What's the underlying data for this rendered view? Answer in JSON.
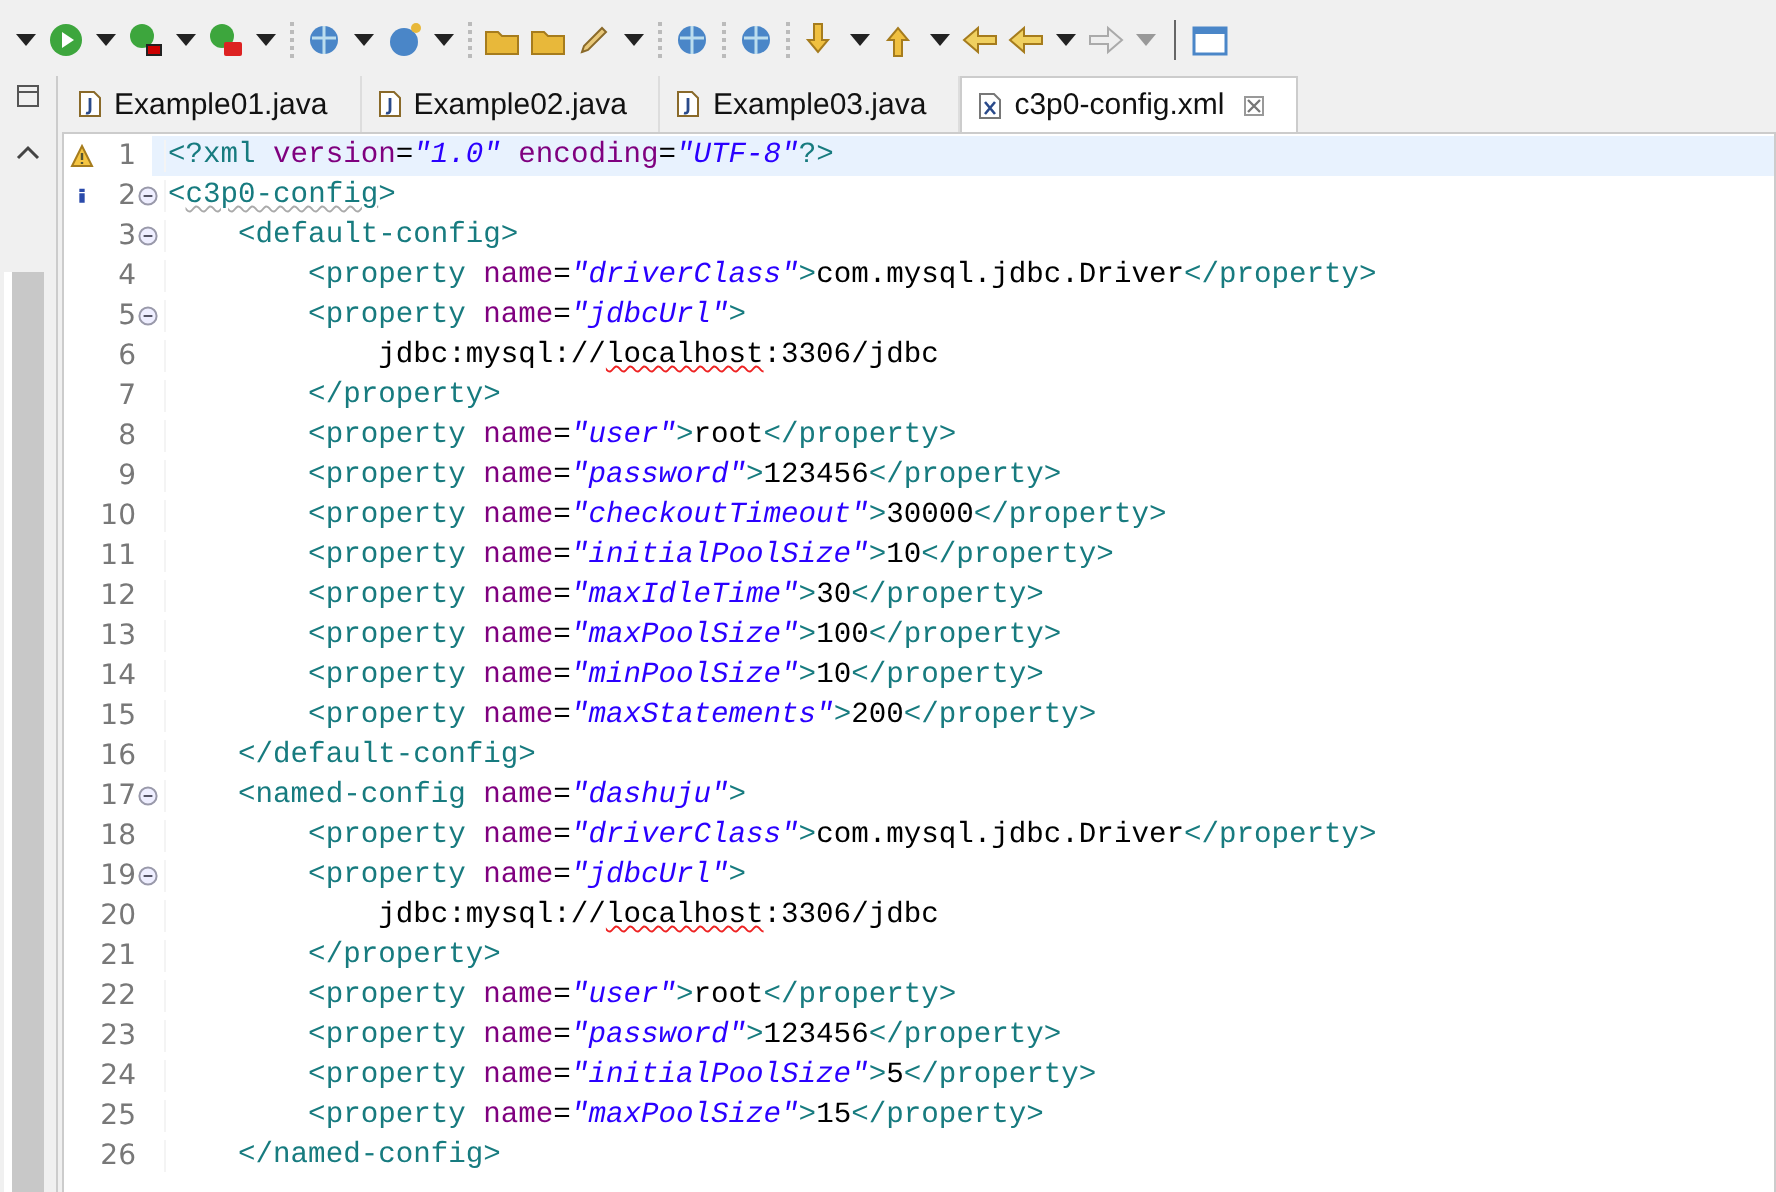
{
  "tabs": [
    {
      "label": "Example01.java",
      "kind": "java",
      "selected": false
    },
    {
      "label": "Example02.java",
      "kind": "java",
      "selected": false
    },
    {
      "label": "Example03.java",
      "kind": "java",
      "selected": false
    },
    {
      "label": "c3p0-config.xml",
      "kind": "xml",
      "selected": true
    }
  ],
  "editor": {
    "lines": [
      {
        "number": "1",
        "warning": true,
        "current": true,
        "tokens": [
          {
            "kind": "tag",
            "text": "<?xml "
          },
          {
            "kind": "attr",
            "text": "version"
          },
          {
            "kind": "text",
            "text": "="
          },
          {
            "kind": "value",
            "text": "\"1.0\" "
          },
          {
            "kind": "attr",
            "text": "encoding"
          },
          {
            "kind": "text",
            "text": "="
          },
          {
            "kind": "value",
            "text": "\"UTF-8\""
          },
          {
            "kind": "tag",
            "text": "?>"
          }
        ]
      },
      {
        "number": "2",
        "info": true,
        "expanded": true,
        "tokens": [
          {
            "kind": "tag",
            "text": "<"
          },
          {
            "kind": "tag",
            "text": "c3p0-config",
            "flagged": true
          },
          {
            "kind": "tag",
            "text": ">"
          }
        ]
      },
      {
        "number": "3",
        "expanded": true,
        "tokens": [
          {
            "kind": "tag",
            "text": "    <default-config>"
          }
        ]
      },
      {
        "number": "4",
        "tokens": [
          {
            "kind": "tag",
            "text": "        <property "
          },
          {
            "kind": "attr",
            "text": "name"
          },
          {
            "kind": "text",
            "text": "="
          },
          {
            "kind": "value",
            "text": "\"driverClass\""
          },
          {
            "kind": "tag",
            "text": ">"
          },
          {
            "kind": "text",
            "text": "com.mysql.jdbc.Driver"
          },
          {
            "kind": "tag",
            "text": "</property>"
          }
        ]
      },
      {
        "number": "5",
        "expanded": true,
        "tokens": [
          {
            "kind": "tag",
            "text": "        <property "
          },
          {
            "kind": "attr",
            "text": "name"
          },
          {
            "kind": "text",
            "text": "="
          },
          {
            "kind": "value",
            "text": "\"jdbcUrl\""
          },
          {
            "kind": "tag",
            "text": ">"
          }
        ]
      },
      {
        "number": "6",
        "tokens": [
          {
            "kind": "text",
            "text": "            jdbc:mysql://"
          },
          {
            "kind": "text",
            "text": "localhost",
            "misspelled": true
          },
          {
            "kind": "text",
            "text": ":3306/jdbc"
          }
        ]
      },
      {
        "number": "7",
        "tokens": [
          {
            "kind": "tag",
            "text": "        </property>"
          }
        ]
      },
      {
        "number": "8",
        "tokens": [
          {
            "kind": "tag",
            "text": "        <property "
          },
          {
            "kind": "attr",
            "text": "name"
          },
          {
            "kind": "text",
            "text": "="
          },
          {
            "kind": "value",
            "text": "\"user\""
          },
          {
            "kind": "tag",
            "text": ">"
          },
          {
            "kind": "text",
            "text": "root"
          },
          {
            "kind": "tag",
            "text": "</property>"
          }
        ]
      },
      {
        "number": "9",
        "tokens": [
          {
            "kind": "tag",
            "text": "        <property "
          },
          {
            "kind": "attr",
            "text": "name"
          },
          {
            "kind": "text",
            "text": "="
          },
          {
            "kind": "value",
            "text": "\"password\""
          },
          {
            "kind": "tag",
            "text": ">"
          },
          {
            "kind": "text",
            "text": "123456"
          },
          {
            "kind": "tag",
            "text": "</property>"
          }
        ]
      },
      {
        "number": "10",
        "tokens": [
          {
            "kind": "tag",
            "text": "        <property "
          },
          {
            "kind": "attr",
            "text": "name"
          },
          {
            "kind": "text",
            "text": "="
          },
          {
            "kind": "value",
            "text": "\"checkoutTimeout\""
          },
          {
            "kind": "tag",
            "text": ">"
          },
          {
            "kind": "text",
            "text": "30000"
          },
          {
            "kind": "tag",
            "text": "</property>"
          }
        ]
      },
      {
        "number": "11",
        "tokens": [
          {
            "kind": "tag",
            "text": "        <property "
          },
          {
            "kind": "attr",
            "text": "name"
          },
          {
            "kind": "text",
            "text": "="
          },
          {
            "kind": "value",
            "text": "\"initialPoolSize\""
          },
          {
            "kind": "tag",
            "text": ">"
          },
          {
            "kind": "text",
            "text": "10"
          },
          {
            "kind": "tag",
            "text": "</property>"
          }
        ]
      },
      {
        "number": "12",
        "tokens": [
          {
            "kind": "tag",
            "text": "        <property "
          },
          {
            "kind": "attr",
            "text": "name"
          },
          {
            "kind": "text",
            "text": "="
          },
          {
            "kind": "value",
            "text": "\"maxIdleTime\""
          },
          {
            "kind": "tag",
            "text": ">"
          },
          {
            "kind": "text",
            "text": "30"
          },
          {
            "kind": "tag",
            "text": "</property>"
          }
        ]
      },
      {
        "number": "13",
        "tokens": [
          {
            "kind": "tag",
            "text": "        <property "
          },
          {
            "kind": "attr",
            "text": "name"
          },
          {
            "kind": "text",
            "text": "="
          },
          {
            "kind": "value",
            "text": "\"maxPoolSize\""
          },
          {
            "kind": "tag",
            "text": ">"
          },
          {
            "kind": "text",
            "text": "100"
          },
          {
            "kind": "tag",
            "text": "</property>"
          }
        ]
      },
      {
        "number": "14",
        "tokens": [
          {
            "kind": "tag",
            "text": "        <property "
          },
          {
            "kind": "attr",
            "text": "name"
          },
          {
            "kind": "text",
            "text": "="
          },
          {
            "kind": "value",
            "text": "\"minPoolSize\""
          },
          {
            "kind": "tag",
            "text": ">"
          },
          {
            "kind": "text",
            "text": "10"
          },
          {
            "kind": "tag",
            "text": "</property>"
          }
        ]
      },
      {
        "number": "15",
        "tokens": [
          {
            "kind": "tag",
            "text": "        <property "
          },
          {
            "kind": "attr",
            "text": "name"
          },
          {
            "kind": "text",
            "text": "="
          },
          {
            "kind": "value",
            "text": "\"maxStatements\""
          },
          {
            "kind": "tag",
            "text": ">"
          },
          {
            "kind": "text",
            "text": "200"
          },
          {
            "kind": "tag",
            "text": "</property>"
          }
        ]
      },
      {
        "number": "16",
        "tokens": [
          {
            "kind": "tag",
            "text": "    </default-config>"
          }
        ]
      },
      {
        "number": "17",
        "expanded": true,
        "tokens": [
          {
            "kind": "tag",
            "text": "    <named-config "
          },
          {
            "kind": "attr",
            "text": "name"
          },
          {
            "kind": "text",
            "text": "="
          },
          {
            "kind": "value",
            "text": "\"dashuju\""
          },
          {
            "kind": "tag",
            "text": ">"
          }
        ]
      },
      {
        "number": "18",
        "tokens": [
          {
            "kind": "tag",
            "text": "        <property "
          },
          {
            "kind": "attr",
            "text": "name"
          },
          {
            "kind": "text",
            "text": "="
          },
          {
            "kind": "value",
            "text": "\"driverClass\""
          },
          {
            "kind": "tag",
            "text": ">"
          },
          {
            "kind": "text",
            "text": "com.mysql.jdbc.Driver"
          },
          {
            "kind": "tag",
            "text": "</property>"
          }
        ]
      },
      {
        "number": "19",
        "expanded": true,
        "tokens": [
          {
            "kind": "tag",
            "text": "        <property "
          },
          {
            "kind": "attr",
            "text": "name"
          },
          {
            "kind": "text",
            "text": "="
          },
          {
            "kind": "value",
            "text": "\"jdbcUrl\""
          },
          {
            "kind": "tag",
            "text": ">"
          }
        ]
      },
      {
        "number": "20",
        "tokens": [
          {
            "kind": "text",
            "text": "            jdbc:mysql://"
          },
          {
            "kind": "text",
            "text": "localhost",
            "misspelled": true
          },
          {
            "kind": "text",
            "text": ":3306/jdbc"
          }
        ]
      },
      {
        "number": "21",
        "tokens": [
          {
            "kind": "tag",
            "text": "        </property>"
          }
        ]
      },
      {
        "number": "22",
        "tokens": [
          {
            "kind": "tag",
            "text": "        <property "
          },
          {
            "kind": "attr",
            "text": "name"
          },
          {
            "kind": "text",
            "text": "="
          },
          {
            "kind": "value",
            "text": "\"user\""
          },
          {
            "kind": "tag",
            "text": ">"
          },
          {
            "kind": "text",
            "text": "root"
          },
          {
            "kind": "tag",
            "text": "</property>"
          }
        ]
      },
      {
        "number": "23",
        "tokens": [
          {
            "kind": "tag",
            "text": "        <property "
          },
          {
            "kind": "attr",
            "text": "name"
          },
          {
            "kind": "text",
            "text": "="
          },
          {
            "kind": "value",
            "text": "\"password\""
          },
          {
            "kind": "tag",
            "text": ">"
          },
          {
            "kind": "text",
            "text": "123456"
          },
          {
            "kind": "tag",
            "text": "</property>"
          }
        ]
      },
      {
        "number": "24",
        "tokens": [
          {
            "kind": "tag",
            "text": "        <property "
          },
          {
            "kind": "attr",
            "text": "name"
          },
          {
            "kind": "text",
            "text": "="
          },
          {
            "kind": "value",
            "text": "\"initialPoolSize\""
          },
          {
            "kind": "tag",
            "text": ">"
          },
          {
            "kind": "text",
            "text": "5"
          },
          {
            "kind": "tag",
            "text": "</property>"
          }
        ]
      },
      {
        "number": "25",
        "tokens": [
          {
            "kind": "tag",
            "text": "        <property "
          },
          {
            "kind": "attr",
            "text": "name"
          },
          {
            "kind": "text",
            "text": "="
          },
          {
            "kind": "value",
            "text": "\"maxPoolSize\""
          },
          {
            "kind": "tag",
            "text": ">"
          },
          {
            "kind": "text",
            "text": "15"
          },
          {
            "kind": "tag",
            "text": "</property>"
          }
        ]
      },
      {
        "number": "26",
        "tokens": [
          {
            "kind": "tag",
            "text": "    </named-config>"
          }
        ]
      }
    ]
  }
}
